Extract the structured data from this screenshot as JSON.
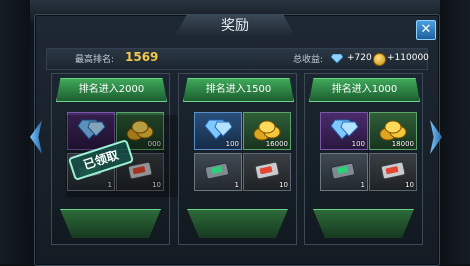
{
  "window": {
    "title": "奖励",
    "close_glyph": "✕"
  },
  "info": {
    "rank_label": "最高排名:",
    "rank_value": "1569",
    "earnings_label": "总收益:",
    "gem_total": "+720",
    "coin_total": "+110000",
    "gem_icon": "gem-icon",
    "coin_icon": "coin-icon"
  },
  "stamp_text": "已领取",
  "cards": [
    {
      "title": "排名进入2000",
      "claimed": true,
      "items": [
        {
          "icon": "gem-icon",
          "qty": ""
        },
        {
          "icon": "coin-icon",
          "qty": "000"
        },
        {
          "icon": "ticket-icon",
          "qty": "1"
        },
        {
          "icon": "exp-card-icon",
          "qty": "10"
        }
      ]
    },
    {
      "title": "排名进入1500",
      "claimed": false,
      "items": [
        {
          "icon": "gem-icon",
          "qty": "100"
        },
        {
          "icon": "coin-icon",
          "qty": "16000"
        },
        {
          "icon": "ticket-icon",
          "qty": "1"
        },
        {
          "icon": "exp-card-icon",
          "qty": "10"
        }
      ]
    },
    {
      "title": "排名进入1000",
      "claimed": false,
      "items": [
        {
          "icon": "gem-icon",
          "qty": "100"
        },
        {
          "icon": "coin-icon",
          "qty": "18000"
        },
        {
          "icon": "ticket-icon",
          "qty": "1"
        },
        {
          "icon": "exp-card-icon",
          "qty": "10"
        }
      ]
    }
  ],
  "colors": {
    "accent_green": "#3ea85a",
    "rank_gold": "#f2c94c",
    "title_blue": "#4aa0e0"
  }
}
